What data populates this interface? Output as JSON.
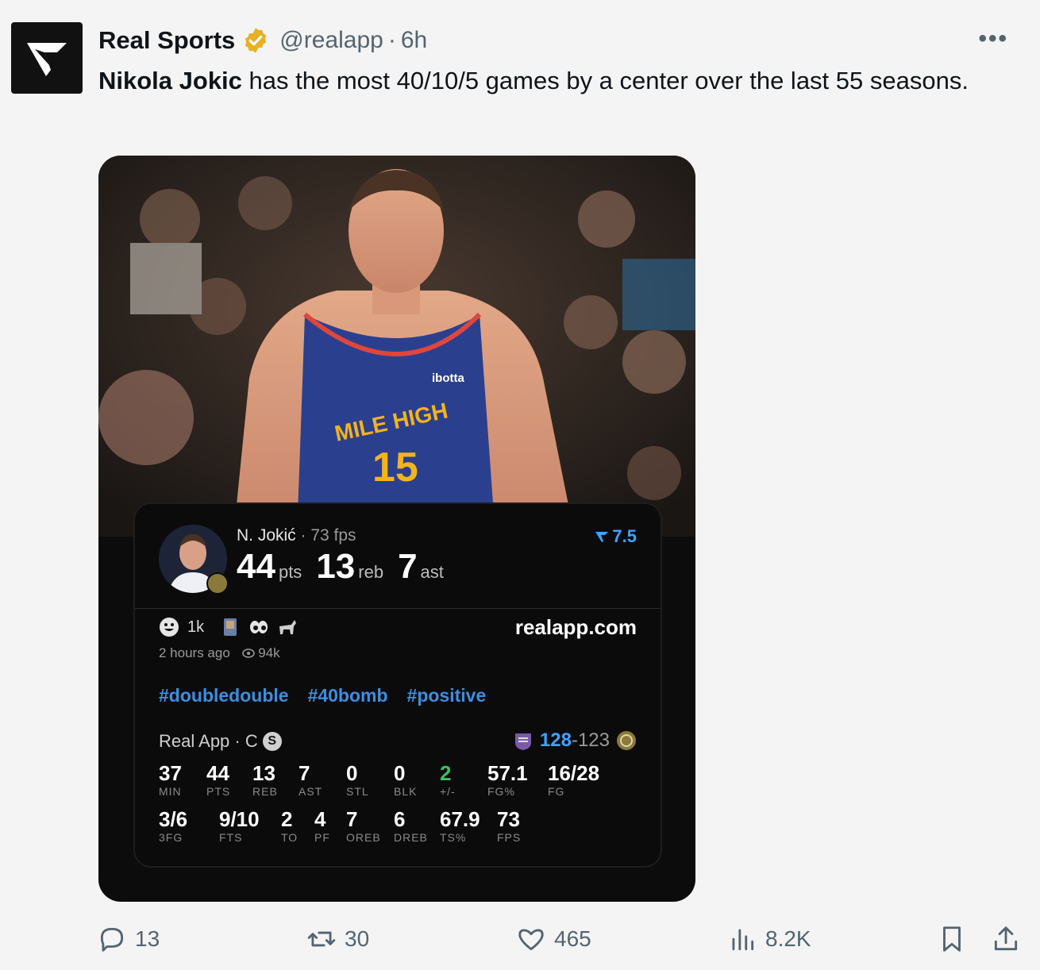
{
  "account": {
    "name": "Real Sports",
    "handle": "@realapp",
    "separator": "·",
    "time": "6h",
    "more_label": "•••"
  },
  "tweet": {
    "bold_text": "Nikola Jokic",
    "text": " has the most 40/10/5 games by a center over the last 55 seasons."
  },
  "card": {
    "player_name": "N. Jokić",
    "player_fps": " · 73 fps",
    "headline": [
      {
        "value": "44",
        "label": "pts"
      },
      {
        "value": "13",
        "label": "reb"
      },
      {
        "value": "7",
        "label": "ast"
      }
    ],
    "rating": "7.5",
    "reaction_count": "1k",
    "time_ago": "2 hours ago",
    "views": "94k",
    "site": "realapp.com",
    "tags": [
      "#doubledouble",
      "#40bomb",
      "#positive"
    ],
    "game_label": "Real App · C",
    "game_badge": "S",
    "score_1": "128",
    "score_sep": "-",
    "score_2": "123",
    "stats_row1": [
      {
        "value": "37",
        "label": "MIN"
      },
      {
        "value": "44",
        "label": "PTS"
      },
      {
        "value": "13",
        "label": "REB"
      },
      {
        "value": "7",
        "label": "AST"
      },
      {
        "value": "0",
        "label": "STL"
      },
      {
        "value": "0",
        "label": "BLK"
      },
      {
        "value": "2",
        "label": "+/-"
      },
      {
        "value": "57.1",
        "label": "FG%"
      },
      {
        "value": "16/28",
        "label": "FG"
      }
    ],
    "stats_row2": [
      {
        "value": "3/6",
        "label": "3FG"
      },
      {
        "value": "9/10",
        "label": "FTS"
      },
      {
        "value": "2",
        "label": "TO"
      },
      {
        "value": "4",
        "label": "PF"
      },
      {
        "value": "7",
        "label": "OREB"
      },
      {
        "value": "6",
        "label": "DREB"
      },
      {
        "value": "67.9",
        "label": "TS%"
      },
      {
        "value": "73",
        "label": "FPS"
      }
    ],
    "jersey_text": "MILE HIGH",
    "jersey_number": "15",
    "sponsor": "ibotta"
  },
  "actions": {
    "replies": "13",
    "reposts": "30",
    "likes": "465",
    "views": "8.2K"
  },
  "colors": {
    "accent_blue": "#3ea3ff",
    "tag_blue": "#3b8fe0",
    "verified_gold": "#e8b023",
    "plusminus_green": "#3fbf5f"
  }
}
